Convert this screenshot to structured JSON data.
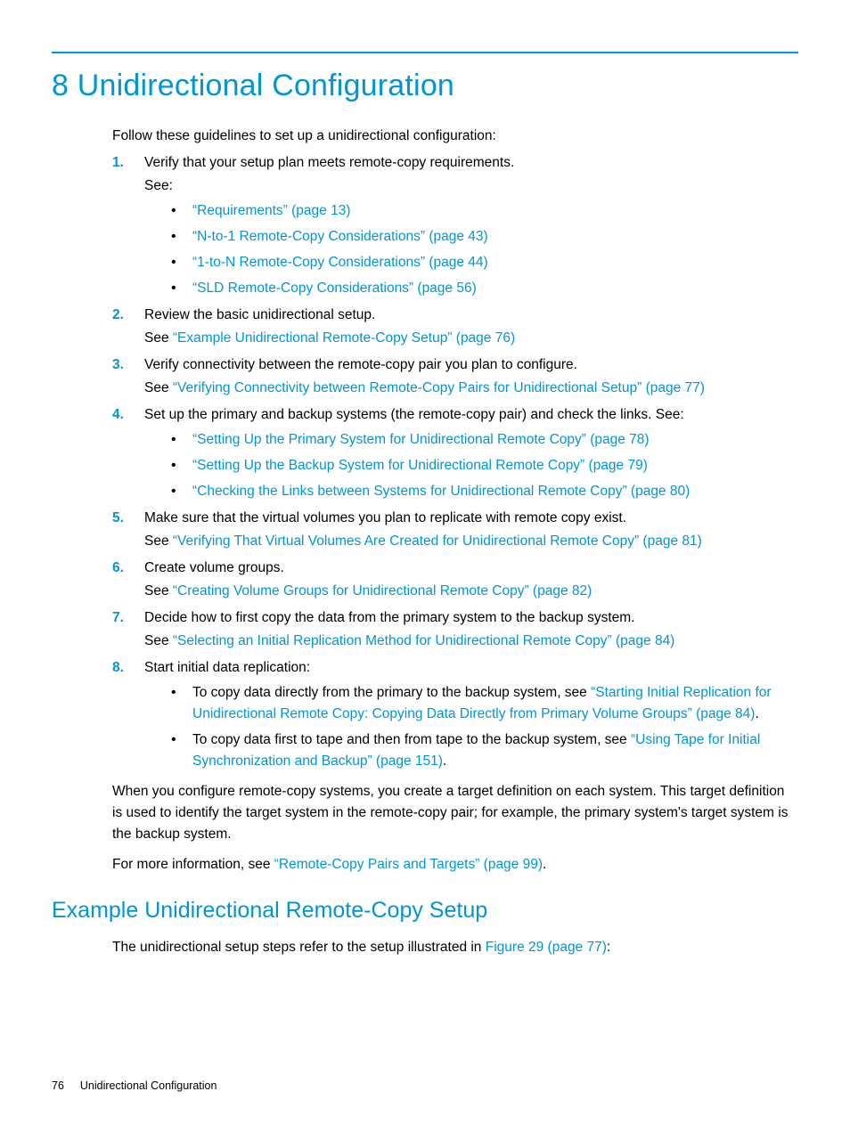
{
  "page": {
    "heading": "8 Unidirectional Configuration",
    "intro": "Follow these guidelines to set up a unidirectional configuration:",
    "steps": [
      {
        "text": "Verify that your setup plan meets remote-copy requirements.",
        "see_plain": "See:",
        "bullets": [
          {
            "prefix": "",
            "link": "“Requirements” (page 13)",
            "suffix": ""
          },
          {
            "prefix": "",
            "link": "“N-to-1 Remote-Copy Considerations” (page 43)",
            "suffix": ""
          },
          {
            "prefix": "",
            "link": "“1-to-N Remote-Copy Considerations” (page 44)",
            "suffix": ""
          },
          {
            "prefix": "",
            "link": "“SLD Remote-Copy Considerations” (page 56)",
            "suffix": ""
          }
        ]
      },
      {
        "text": "Review the basic unidirectional setup.",
        "see_prefix": "See ",
        "see_link": "“Example Unidirectional Remote-Copy Setup” (page 76)"
      },
      {
        "text": "Verify connectivity between the remote-copy pair you plan to configure.",
        "see_prefix": "See ",
        "see_link": "“Verifying Connectivity between Remote-Copy Pairs for Unidirectional Setup” (page 77)"
      },
      {
        "text": "Set up the primary and backup systems (the remote-copy pair) and check the links. See:",
        "bullets": [
          {
            "prefix": "",
            "link": "“Setting Up the Primary System for Unidirectional Remote Copy” (page 78)",
            "suffix": ""
          },
          {
            "prefix": "",
            "link": "“Setting Up the Backup System for Unidirectional Remote Copy” (page 79)",
            "suffix": ""
          },
          {
            "prefix": "",
            "link": "“Checking the Links between Systems for Unidirectional Remote Copy” (page 80)",
            "suffix": ""
          }
        ]
      },
      {
        "text": "Make sure that the virtual volumes you plan to replicate with remote copy exist.",
        "see_prefix": "See ",
        "see_link": "“Verifying That Virtual Volumes Are Created for Unidirectional Remote Copy” (page 81)"
      },
      {
        "text": "Create volume groups.",
        "see_prefix": "See ",
        "see_link": "“Creating Volume Groups for Unidirectional Remote Copy” (page 82)"
      },
      {
        "text": "Decide how to first copy the data from the primary system to the backup system.",
        "see_prefix": "See ",
        "see_link": "“Selecting an Initial Replication Method for Unidirectional Remote Copy” (page 84)"
      },
      {
        "text": "Start initial data replication:",
        "bullets": [
          {
            "prefix": "To copy data directly from the primary to the backup system, see ",
            "link": "“Starting Initial Replication for Unidirectional Remote Copy: Copying Data Directly from Primary Volume Groups” (page 84)",
            "suffix": "."
          },
          {
            "prefix": "To copy data first to tape and then from tape to the backup system, see ",
            "link": "“Using Tape for Initial Synchronization and Backup” (page 151)",
            "suffix": "."
          }
        ]
      }
    ],
    "after1": "When you configure remote-copy systems, you create a target definition on each system. This target definition is used to identify the target system in the remote-copy pair; for example, the primary system's target system is the backup system.",
    "after2_prefix": "For more information, see ",
    "after2_link": "“Remote-Copy Pairs and Targets” (page 99)",
    "after2_suffix": ".",
    "section2_heading": "Example Unidirectional Remote-Copy Setup",
    "section2_text_prefix": "The unidirectional setup steps refer to the setup illustrated in ",
    "section2_link": "Figure 29 (page 77)",
    "section2_text_suffix": ":"
  },
  "footer": {
    "pagenum": "76",
    "title": "Unidirectional Configuration"
  }
}
